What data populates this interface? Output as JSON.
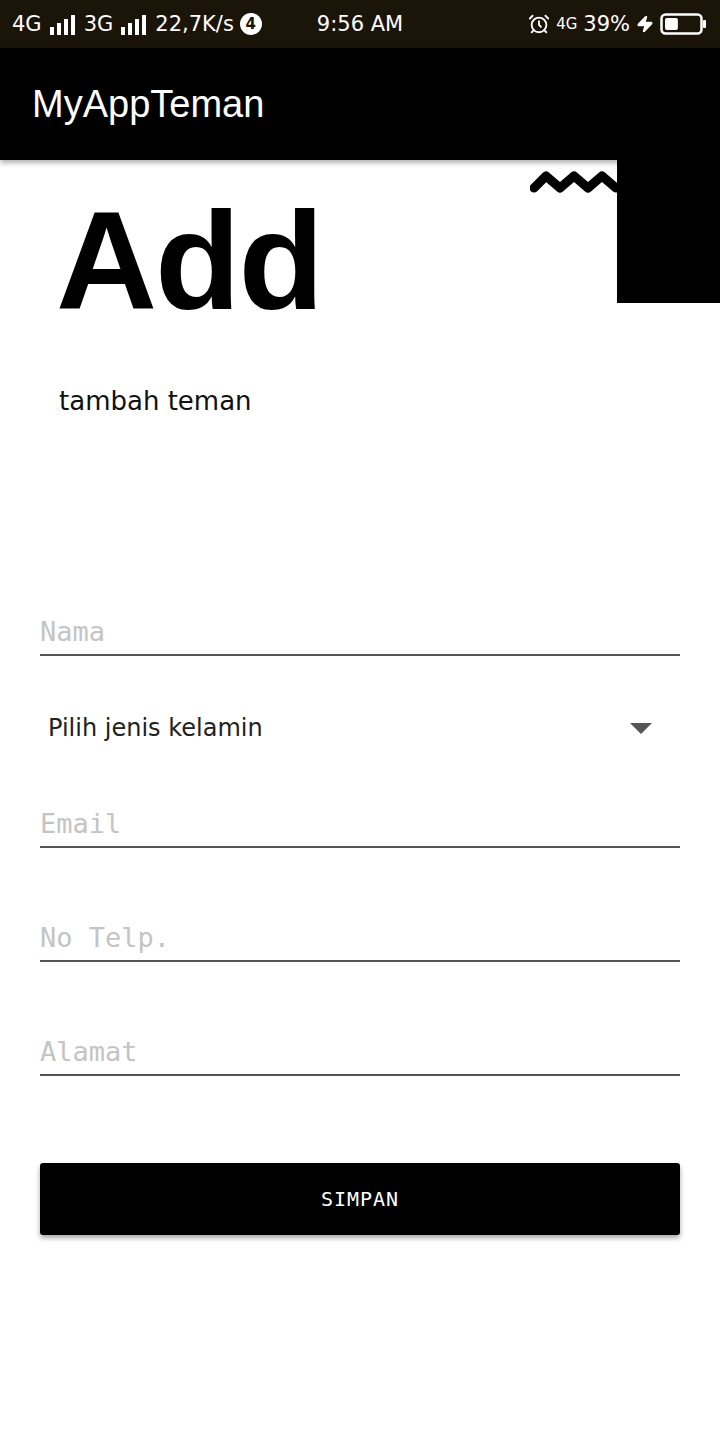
{
  "status_bar": {
    "network_1": "4G",
    "signal_1": 1,
    "network_2": "3G",
    "signal_2": 1,
    "speed": "22,7K/s",
    "notification_count": "4",
    "time": "9:56 AM",
    "network_3": "4G",
    "battery": "39%",
    "battery_level": 0.39,
    "charging": true
  },
  "app_bar": {
    "title": "MyAppTeman"
  },
  "header": {
    "title": "Add",
    "subtitle": "tambah teman"
  },
  "form": {
    "fields": [
      {
        "kind": "text",
        "placeholder": "Nama"
      },
      {
        "kind": "select",
        "placeholder": "Pilih jenis kelamin"
      },
      {
        "kind": "text",
        "placeholder": "Email"
      },
      {
        "kind": "text",
        "placeholder": "No Telp."
      },
      {
        "kind": "text",
        "placeholder": "Alamat"
      }
    ],
    "submit": "SIMPAN"
  }
}
